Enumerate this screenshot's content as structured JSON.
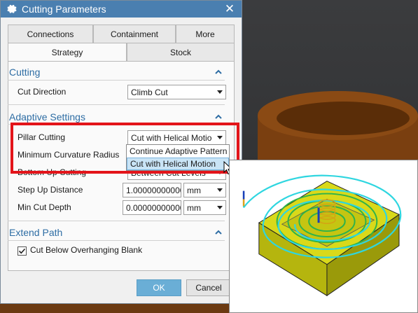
{
  "window": {
    "title": "Cutting Parameters"
  },
  "tabs_top": [
    "Connections",
    "Containment",
    "More"
  ],
  "tabs_second": [
    "Strategy",
    "Stock"
  ],
  "sections": {
    "cutting": {
      "title": "Cutting"
    },
    "adaptive": {
      "title": "Adaptive Settings"
    },
    "extend": {
      "title": "Extend Path"
    }
  },
  "fields": {
    "cut_direction": {
      "label": "Cut Direction",
      "value": "Climb Cut"
    },
    "pillar_cutting": {
      "label": "Pillar Cutting",
      "value": "Cut with Helical Motio"
    },
    "min_curvature": {
      "label": "Minimum Curvature Radius"
    },
    "bottom_up": {
      "label": "Bottom Up Cutting",
      "value": "Between Cut Levels"
    },
    "step_up": {
      "label": "Step Up Distance",
      "value": "1.000000000000",
      "unit": "mm"
    },
    "min_cut_depth": {
      "label": "Min Cut Depth",
      "value": "0.000000000000",
      "unit": "mm"
    }
  },
  "checkbox": {
    "label": "Cut Below Overhanging Blank",
    "checked": true
  },
  "dropdown": {
    "options": [
      "Continue Adaptive Pattern",
      "Cut with Helical Motion"
    ],
    "selected_index": 1
  },
  "buttons": {
    "ok": "OK",
    "cancel": "Cancel"
  },
  "colors": {
    "accent": "#2e6da4",
    "titlebar": "#4a7fb0",
    "highlight": "#e3141a",
    "ok": "#6aaed6"
  },
  "icons": {
    "title": "gear-icon",
    "close": "close-icon",
    "collapse": "chevron-up-icon",
    "check": "check-icon",
    "pointer": "mouse-cursor-icon"
  }
}
